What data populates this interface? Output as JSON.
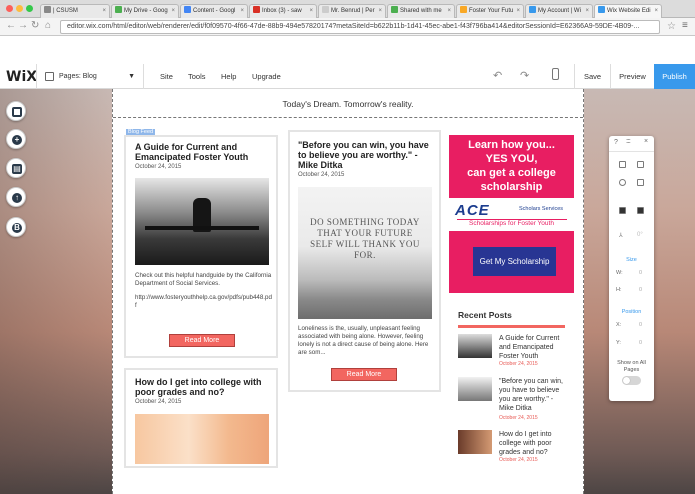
{
  "browser": {
    "tabs": [
      {
        "label": "| CSUSM",
        "color": "#888888",
        "active": false
      },
      {
        "label": "My Drive - Goog",
        "color": "#4caf50",
        "active": false
      },
      {
        "label": "Content - Googl",
        "color": "#4285f4",
        "active": false
      },
      {
        "label": "Inbox (3) - saw",
        "color": "#d93025",
        "active": false
      },
      {
        "label": "Mr. Benrud | Per",
        "color": "#cccccc",
        "active": false
      },
      {
        "label": "Shared with me",
        "color": "#4caf50",
        "active": false
      },
      {
        "label": "Foster Your Futu",
        "color": "#f9a825",
        "active": false
      },
      {
        "label": "My Account | Wi",
        "color": "#3899ec",
        "active": false
      },
      {
        "label": "Wix Website Edi",
        "color": "#3899ec",
        "active": true
      }
    ],
    "url": "editor.wix.com/html/editor/web/renderer/edit/f0f09570-4f66-47de-88b9-494e57820174?metaSiteId=b622b11b-1d41-45ec-abe1-f43f796ba414&editorSessionId=E62366A9-59DE-4B09-...",
    "back_icon": "back-arrow-icon",
    "forward_icon": "forward-arrow-icon"
  },
  "editor": {
    "logo": "WiX",
    "page_selector": "Pages: Blog",
    "menu": [
      "Site",
      "Tools",
      "Help",
      "Upgrade"
    ],
    "save_label": "Save",
    "preview_label": "Preview",
    "publish_label": "Publish",
    "accent": "#3899ec"
  },
  "site": {
    "tagline": "Today's Dream. Tomorrow's reality.",
    "blog_feed_badge": "Blog Feed",
    "posts": [
      {
        "title": "A Guide for Current and Emancipated Foster Youth",
        "date": "October 24, 2015",
        "excerpt": "Check out this helpful handguide by the California Department of Social Services.",
        "link_text": "http://www.fosteryouthhelp.ca.gov/pdfs/pub448.pdf",
        "button": "Read More"
      },
      {
        "title": "\"Before you can win, you have to believe you are worthy.\" - Mike Ditka",
        "date": "October 24, 2015",
        "image_text": "DO SOMETHING TODAY THAT YOUR FUTURE SELF WILL THANK YOU FOR.",
        "excerpt": "Loneliness is the, usually, unpleasant feeling associated with being alone. However, feeling lonely is not a direct cause of being alone. Here are som...",
        "button": "Read More"
      },
      {
        "title": "How do I get into college with poor grades and no?",
        "date": "October 24, 2015"
      }
    ],
    "ad": {
      "headline": "Learn how you... YES YOU, can get a college scholarship",
      "line1": "Learn how you...",
      "line2": "YES YOU,",
      "line3": "can get a college",
      "line4": "scholarship",
      "logo": "ACE",
      "logo_sub": "Scholars Services",
      "tag": "Scholarships for Foster Youth",
      "button": "Get My Scholarship"
    },
    "recent_posts": {
      "heading": "Recent Posts",
      "items": [
        {
          "title": "A Guide for Current and Emancipated Foster Youth",
          "date": "October 24, 2015"
        },
        {
          "title": "\"Before you can win, you have to believe you are worthy.\" - Mike Ditka",
          "date": "October 24, 2015"
        },
        {
          "title": "How do I get into college with poor grades and no?",
          "date": "October 24, 2015"
        }
      ]
    }
  },
  "panel": {
    "help": "?",
    "close": "×",
    "size_label": "Size",
    "w_label": "W:",
    "w_value": "0",
    "h_label": "H:",
    "h_value": "0",
    "position_label": "Position",
    "x_label": "X:",
    "x_value": "0",
    "y_label": "Y:",
    "y_value": "0",
    "show_all_label": "Show on All Pages"
  }
}
